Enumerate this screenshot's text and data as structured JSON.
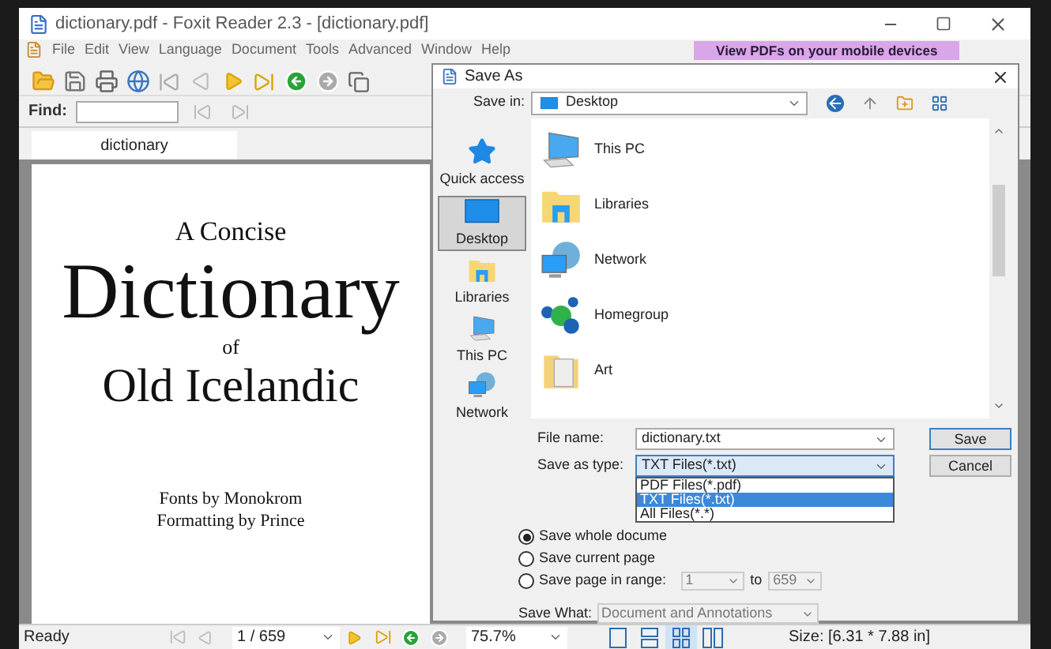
{
  "window": {
    "title": "dictionary.pdf - Foxit Reader 2.3 - [dictionary.pdf]"
  },
  "menu": [
    "File",
    "Edit",
    "View",
    "Language",
    "Document",
    "Tools",
    "Advanced",
    "Window",
    "Help"
  ],
  "ad_banner": "View PDFs on your mobile devices",
  "find": {
    "label": "Find:"
  },
  "tab": {
    "label": "dictionary"
  },
  "document": {
    "lines": [
      {
        "text": "A Concise",
        "kind": "small"
      },
      {
        "text": "Dictionary",
        "kind": "huge"
      },
      {
        "text": "of",
        "kind": "tiny"
      },
      {
        "text": "Old Icelandic",
        "kind": "large"
      },
      {
        "text": "Fonts by Monokrom",
        "kind": "credit"
      },
      {
        "text": "Formatting by Prince",
        "kind": "credit"
      }
    ]
  },
  "status_bar": {
    "status": "Ready",
    "page": "1 / 659",
    "zoom": "75.7%",
    "size": "Size: [6.31 * 7.88 in]",
    "view_modes": [
      {
        "kind": "single",
        "selected": false
      },
      {
        "kind": "continuous",
        "selected": false
      },
      {
        "kind": "grid",
        "selected": true
      },
      {
        "kind": "facing",
        "selected": false
      }
    ]
  },
  "dialog": {
    "title": "Save As",
    "save_in_label": "Save in:",
    "save_in_value": "Desktop",
    "places": [
      {
        "label": "Quick access",
        "kind": "star",
        "selected": false
      },
      {
        "label": "Desktop",
        "kind": "desktop",
        "selected": true
      },
      {
        "label": "Libraries",
        "kind": "libraries",
        "selected": false
      },
      {
        "label": "This PC",
        "kind": "pc",
        "selected": false
      },
      {
        "label": "Network",
        "kind": "network",
        "selected": false
      }
    ],
    "files": [
      {
        "name": "This PC",
        "kind": "pc"
      },
      {
        "name": "Libraries",
        "kind": "libraries"
      },
      {
        "name": "Network",
        "kind": "network"
      },
      {
        "name": "Homegroup",
        "kind": "homegroup"
      },
      {
        "name": "Art",
        "kind": "folder"
      }
    ],
    "file_name_label": "File name:",
    "file_name_value": "dictionary.txt",
    "type_label": "Save as type:",
    "type_value": "TXT Files(*.txt)",
    "type_options": [
      {
        "label": "PDF Files(*.pdf)",
        "selected": false
      },
      {
        "label": "TXT Files(*.txt)",
        "selected": true
      },
      {
        "label": "All Files(*.*)",
        "selected": false
      }
    ],
    "buttons": [
      "Save",
      "Cancel"
    ],
    "options": [
      {
        "label": "Save whole docume",
        "selected": true
      },
      {
        "label": "Save current page",
        "selected": false
      },
      {
        "label": "Save page in range:",
        "selected": false
      }
    ],
    "range_from": "1",
    "range_to_label": "to",
    "range_to": "659",
    "save_what_label": "Save What:",
    "save_what_value": "Document and Annotations"
  }
}
